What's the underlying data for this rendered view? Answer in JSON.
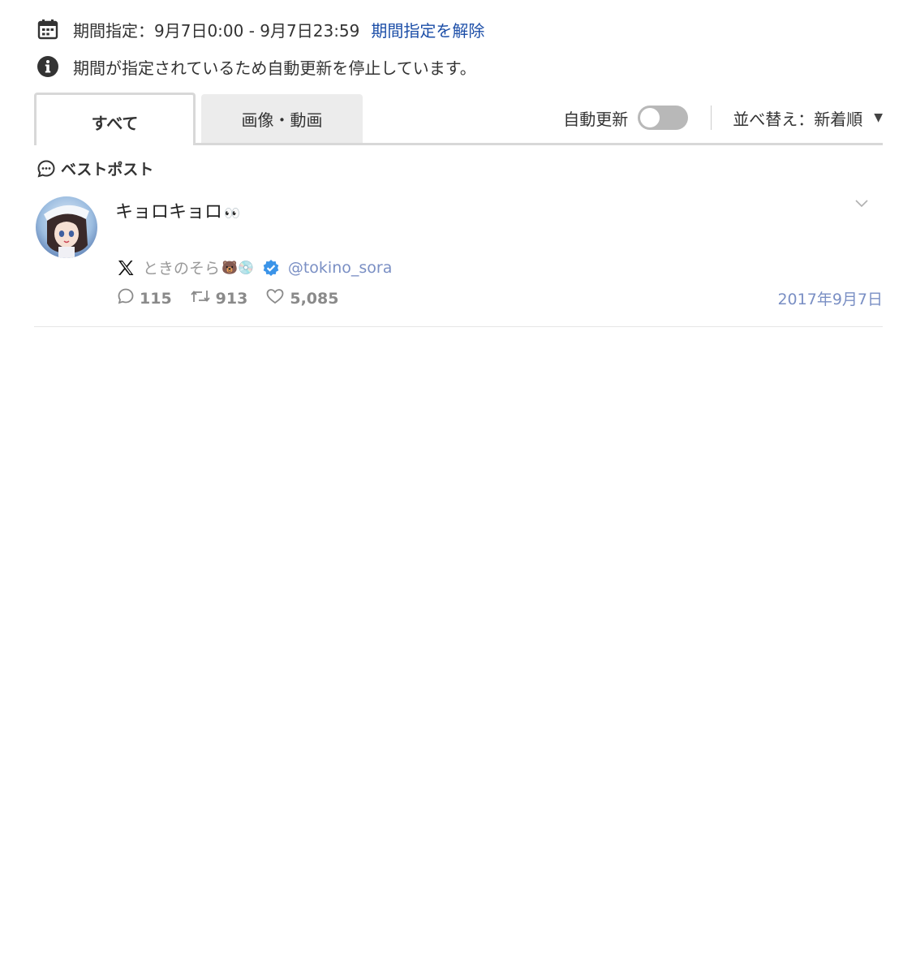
{
  "period": {
    "text": "期間指定：9月7日0:00 - 9月7日23:59",
    "clear_link": "期間指定を解除"
  },
  "notice": {
    "text": "期間が指定されているため自動更新を停止しています。"
  },
  "tabs": [
    {
      "label": "すべて",
      "active": true
    },
    {
      "label": "画像・動画",
      "active": false
    }
  ],
  "toolbar": {
    "auto_update_label": "自動更新",
    "auto_update_on": false,
    "sort_label": "並べ替え：新着順"
  },
  "section": {
    "best_post_label": "ベストポスト"
  },
  "post": {
    "text": "キョロキョロ",
    "text_emoji": "👀",
    "author_name": "ときのそら",
    "author_emoji": "🐻💿",
    "handle": "@tokino_sora",
    "replies": "115",
    "reposts": "913",
    "likes": "5,085",
    "date": "2017年9月7日"
  },
  "colors": {
    "link": "#1d4fa8",
    "handle": "#7a8fc4",
    "verified": "#3b94e8",
    "tab_inactive_bg": "#ececec",
    "toggle_off": "#b8b8b8"
  }
}
